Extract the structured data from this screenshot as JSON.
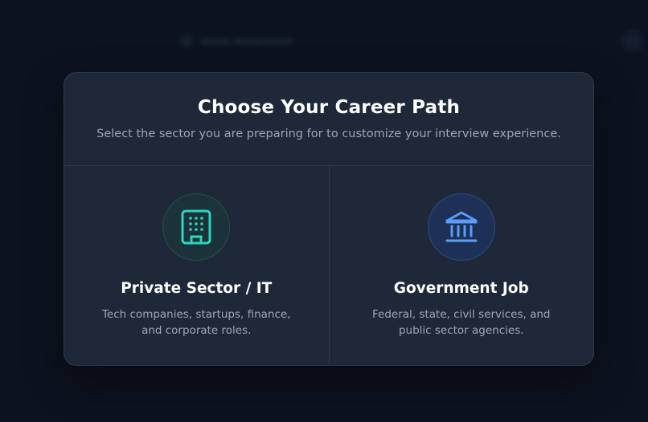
{
  "modal": {
    "title": "Choose Your Career Path",
    "subtitle": "Select the sector you are preparing for to customize your interview experience."
  },
  "options": [
    {
      "title": "Private Sector / IT",
      "description": "Tech companies, startups, finance, and corporate roles.",
      "icon": "building-icon",
      "accent": "#2dd4bf"
    },
    {
      "title": "Government Job",
      "description": "Federal, state, civil services, and public sector agencies.",
      "icon": "bank-icon",
      "accent": "#5b9cf6"
    }
  ]
}
